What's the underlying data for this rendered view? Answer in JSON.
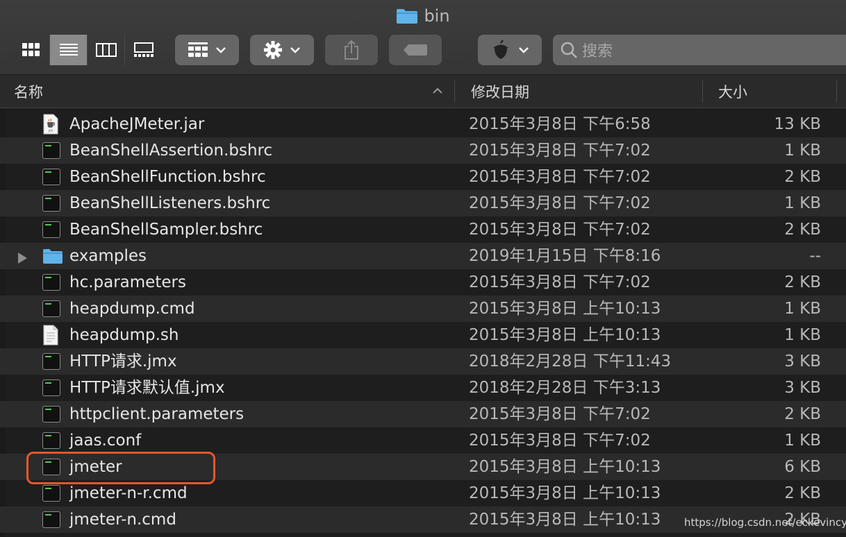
{
  "window": {
    "title": "bin"
  },
  "toolbar": {
    "view_buttons": [
      "icon-view",
      "list-view",
      "column-view",
      "gallery-view"
    ],
    "active_view": "list-view",
    "search_placeholder": "搜索"
  },
  "columns": {
    "name": "名称",
    "date": "修改日期",
    "size": "大小",
    "sort": "ascending"
  },
  "files": [
    {
      "name": "ApacheJMeter.jar",
      "date": "2015年3月8日 下午6:58",
      "size": "13 KB",
      "icon": "jar-icon"
    },
    {
      "name": "BeanShellAssertion.bshrc",
      "date": "2015年3月8日 下午7:02",
      "size": "1 KB",
      "icon": "terminal-file-icon"
    },
    {
      "name": "BeanShellFunction.bshrc",
      "date": "2015年3月8日 下午7:02",
      "size": "2 KB",
      "icon": "terminal-file-icon"
    },
    {
      "name": "BeanShellListeners.bshrc",
      "date": "2015年3月8日 下午7:02",
      "size": "1 KB",
      "icon": "terminal-file-icon"
    },
    {
      "name": "BeanShellSampler.bshrc",
      "date": "2015年3月8日 下午7:02",
      "size": "2 KB",
      "icon": "terminal-file-icon"
    },
    {
      "name": "examples",
      "date": "2019年1月15日 下午8:16",
      "size": "--",
      "icon": "folder-icon"
    },
    {
      "name": "hc.parameters",
      "date": "2015年3月8日 下午7:02",
      "size": "2 KB",
      "icon": "terminal-file-icon"
    },
    {
      "name": "heapdump.cmd",
      "date": "2015年3月8日 上午10:13",
      "size": "1 KB",
      "icon": "terminal-file-icon"
    },
    {
      "name": "heapdump.sh",
      "date": "2015年3月8日 上午10:13",
      "size": "1 KB",
      "icon": "document-icon"
    },
    {
      "name": "HTTP请求.jmx",
      "date": "2018年2月28日 下午11:43",
      "size": "3 KB",
      "icon": "terminal-file-icon"
    },
    {
      "name": "HTTP请求默认值.jmx",
      "date": "2018年2月28日 下午3:13",
      "size": "3 KB",
      "icon": "terminal-file-icon"
    },
    {
      "name": "httpclient.parameters",
      "date": "2015年3月8日 下午7:02",
      "size": "2 KB",
      "icon": "terminal-file-icon"
    },
    {
      "name": "jaas.conf",
      "date": "2015年3月8日 下午7:02",
      "size": "1 KB",
      "icon": "terminal-file-icon"
    },
    {
      "name": "jmeter",
      "date": "2015年3月8日 上午10:13",
      "size": "6 KB",
      "icon": "terminal-file-icon"
    },
    {
      "name": "jmeter-n-r.cmd",
      "date": "2015年3月8日 上午10:13",
      "size": "2 KB",
      "icon": "terminal-file-icon"
    },
    {
      "name": "jmeter-n.cmd",
      "date": "2015年3月8日 上午10:13",
      "size": "2 KB",
      "icon": "terminal-file-icon"
    }
  ],
  "highlighted_file": "jmeter",
  "watermark": "https://blog.csdn.net/eckevincyh",
  "colors": {
    "highlight": "#e8572a",
    "folder": "#5fb4ea",
    "terminal_text": "#4ecb50"
  }
}
